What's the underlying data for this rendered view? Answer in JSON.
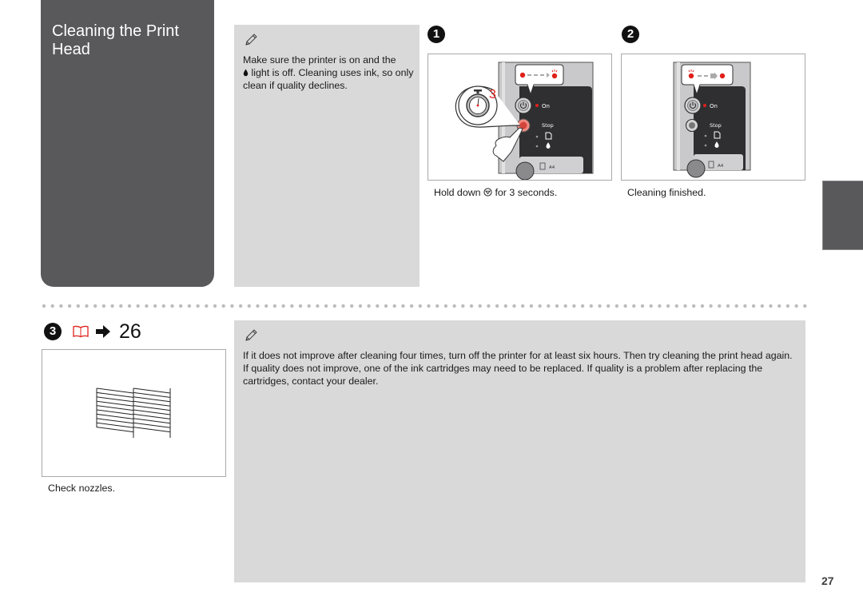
{
  "section": {
    "title": "Cleaning the Print Head"
  },
  "note_top": {
    "icon": "pencil-icon",
    "text_before_icon": "Make sure the printer is on and the",
    "inline_icon": "ink-drop-icon",
    "text_after_icon": "light is off. Cleaning uses ink, so only clean if quality declines."
  },
  "steps": [
    {
      "number": "1",
      "caption_prefix": "Hold down",
      "caption_icon": "stop-button-icon",
      "caption_suffix": "for 3 seconds.",
      "timer_seconds": "3",
      "panel_labels": {
        "on": "On",
        "stop": "Stop",
        "paper": "A4"
      }
    },
    {
      "number": "2",
      "caption": "Cleaning finished.",
      "panel_labels": {
        "on": "On",
        "stop": "Stop",
        "paper": "A4"
      }
    },
    {
      "number": "3",
      "reference_icon": "manual-book-icon",
      "reference_arrow": "arrow-right-icon",
      "reference_page": "26",
      "caption": "Check nozzles."
    }
  ],
  "note_bottom": {
    "icon": "pencil-icon",
    "text": "If it does not improve after cleaning four times, turn off the printer for at least six hours. Then try cleaning the print head again. If quality does not improve, one of the ink cartridges may need to be replaced. If quality is a problem after replacing the cartridges, contact your dealer."
  },
  "page_number": "27",
  "colors": {
    "title_panel": "#59585a",
    "note_bg": "#d9d9da",
    "accent_red": "#e0201b",
    "figure_border": "#a9a9ab"
  }
}
